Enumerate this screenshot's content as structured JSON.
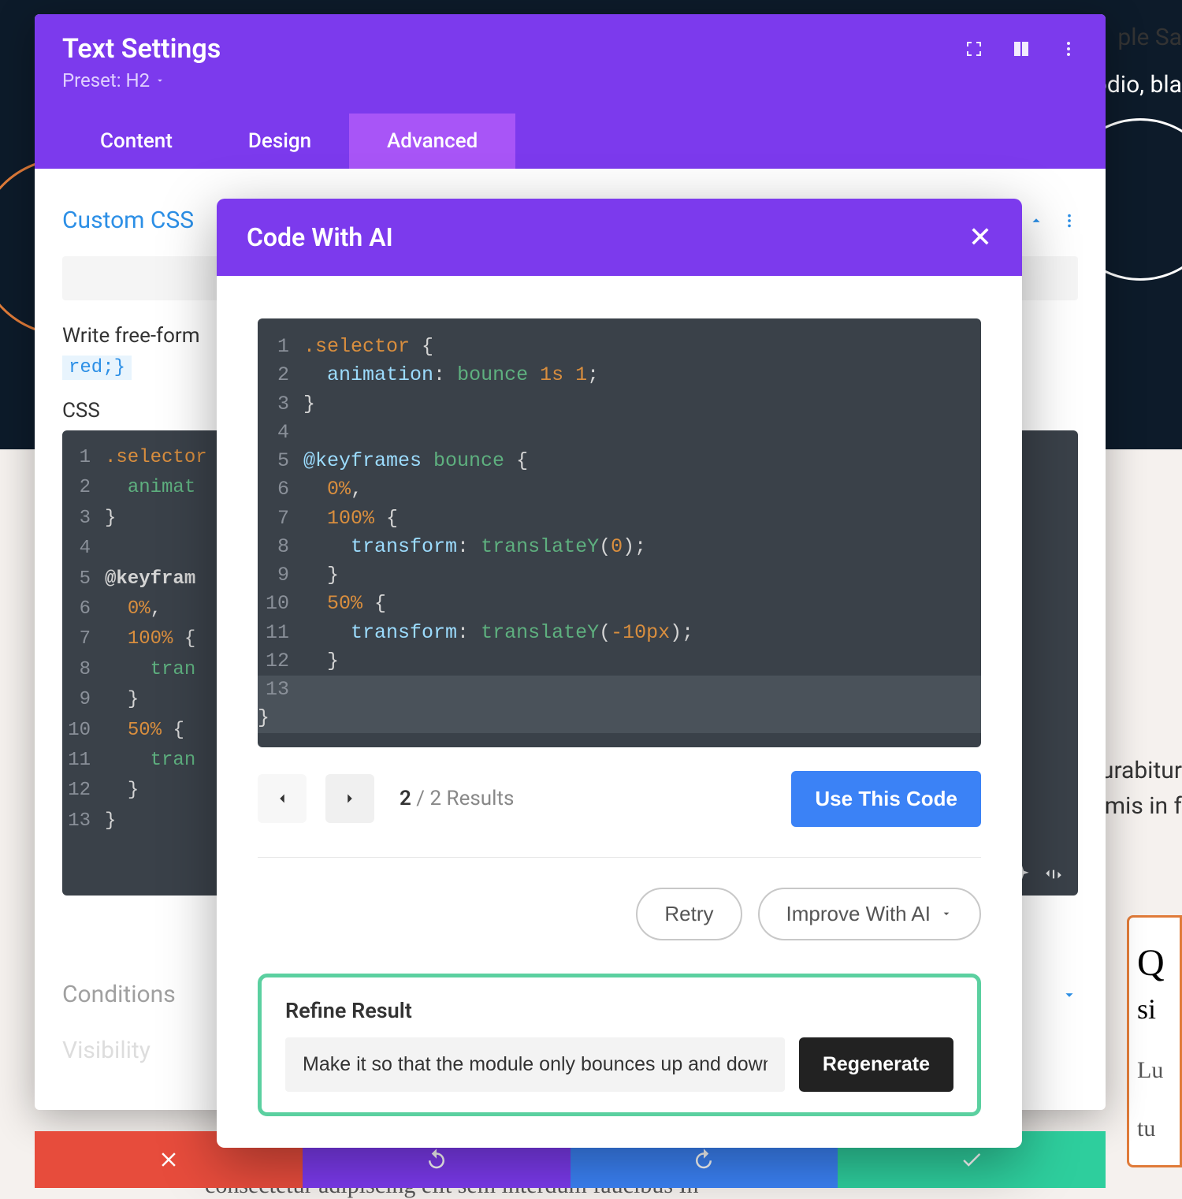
{
  "bg": {
    "top_right_1": "ple   Sa",
    "top_right_2": "odio, bla",
    "mid_right_1": "Curabitur",
    "mid_right_2": "rimis in f",
    "side_q": "Q",
    "side_si": "si",
    "side_lu": "Lu",
    "side_tu": "tu",
    "bottom": "consectetur adipiscing elit          sem interdum faucibus  In"
  },
  "modal": {
    "title": "Text Settings",
    "preset_label": "Preset: H2",
    "tabs": [
      "Content",
      "Design",
      "Advanced"
    ],
    "active_tab": 2,
    "section_custom_css": "Custom CSS",
    "help_text": "Write free-form",
    "code_inline": "red;}",
    "css_label": "CSS",
    "sections": {
      "conditions": "Conditions",
      "visibility": "Visibility"
    },
    "code": {
      "lines": [
        {
          "n": "1",
          "html": "<span class='tok-sel'>.selector</span> <span class='tok-punct'>{</span>"
        },
        {
          "n": "2",
          "html": "  <span class='tok-val'>animat</span>"
        },
        {
          "n": "3",
          "html": "<span class='tok-punct'>}</span>"
        },
        {
          "n": "4",
          "html": ""
        },
        {
          "n": "5",
          "html": "<span class='tok-kw'>@keyfram</span>"
        },
        {
          "n": "6",
          "html": "  <span class='tok-num'>0%</span><span class='tok-punct'>,</span>"
        },
        {
          "n": "7",
          "html": "  <span class='tok-num'>100%</span> <span class='tok-punct'>{</span>"
        },
        {
          "n": "8",
          "html": "    <span class='tok-val'>tran</span>"
        },
        {
          "n": "9",
          "html": "  <span class='tok-punct'>}</span>"
        },
        {
          "n": "10",
          "html": "  <span class='tok-num'>50%</span> <span class='tok-punct'>{</span>"
        },
        {
          "n": "11",
          "html": "    <span class='tok-val'>tran</span>"
        },
        {
          "n": "12",
          "html": "  <span class='tok-punct'>}</span>"
        },
        {
          "n": "13",
          "html": "<span class='tok-punct'>}</span>"
        }
      ]
    }
  },
  "ai_modal": {
    "title": "Code With AI",
    "code": {
      "lines": [
        {
          "n": "1",
          "html": "<span class='tok-sel'>.selector</span> <span class='tok-punct'>{</span>"
        },
        {
          "n": "2",
          "html": "  <span class='tok-prop'>animation</span><span class='tok-punct'>:</span> <span class='tok-val'>bounce</span> <span class='tok-num'>1s</span> <span class='tok-num'>1</span><span class='tok-punct'>;</span>"
        },
        {
          "n": "3",
          "html": "<span class='tok-punct'>}</span>"
        },
        {
          "n": "4",
          "html": ""
        },
        {
          "n": "5",
          "html": "<span class='tok-prop'>@keyframes</span> <span class='tok-val'>bounce</span> <span class='tok-punct'>{</span>"
        },
        {
          "n": "6",
          "html": "  <span class='tok-num'>0%</span><span class='tok-punct'>,</span>"
        },
        {
          "n": "7",
          "html": "  <span class='tok-num'>100%</span> <span class='tok-punct'>{</span>"
        },
        {
          "n": "8",
          "html": "    <span class='tok-prop'>transform</span><span class='tok-punct'>:</span> <span class='tok-val'>translateY</span><span class='tok-punct'>(</span><span class='tok-num'>0</span><span class='tok-punct'>);</span>"
        },
        {
          "n": "9",
          "html": "  <span class='tok-punct'>}</span>"
        },
        {
          "n": "10",
          "html": "  <span class='tok-num'>50%</span> <span class='tok-punct'>{</span>"
        },
        {
          "n": "11",
          "html": "    <span class='tok-prop'>transform</span><span class='tok-punct'>:</span> <span class='tok-val'>translateY</span><span class='tok-punct'>(</span><span class='tok-num'>-10px</span><span class='tok-punct'>);</span>"
        },
        {
          "n": "12",
          "html": "  <span class='tok-punct'>}</span>"
        },
        {
          "n": "13",
          "html": "<span class='tok-punct'>}</span>",
          "hl": true
        }
      ]
    },
    "results_current": "2",
    "results_total": "2 Results",
    "use_button": "Use This Code",
    "retry": "Retry",
    "improve": "Improve With AI",
    "refine_label": "Refine Result",
    "refine_value": "Make it so that the module only bounces up and down one",
    "regenerate": "Regenerate"
  }
}
